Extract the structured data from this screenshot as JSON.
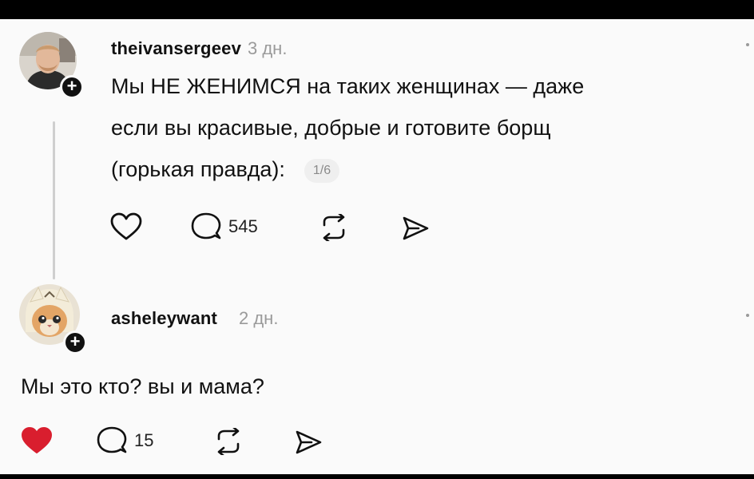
{
  "posts": [
    {
      "username": "theivansergeev",
      "time": "3 дн.",
      "text_lines": [
        "Мы НЕ ЖЕНИМСЯ на таких женщинах — даже",
        "если вы красивые, добрые и готовите борщ",
        "(горькая правда):"
      ],
      "carousel_counter": "1/6",
      "reply_count": "545",
      "liked": false,
      "follow_badge": "+"
    },
    {
      "username": "asheleywant",
      "time": "2 дн.",
      "text": "Мы это кто? вы и мама?",
      "reply_count": "15",
      "liked": true,
      "follow_badge": "+"
    }
  ],
  "colors": {
    "like_active": "#d91e2e",
    "text": "#111111",
    "muted": "#9a9a9a",
    "background": "#fafafa"
  },
  "icons": [
    "heart-icon",
    "comment-bubble-icon",
    "repost-icon",
    "send-icon",
    "plus-icon"
  ]
}
